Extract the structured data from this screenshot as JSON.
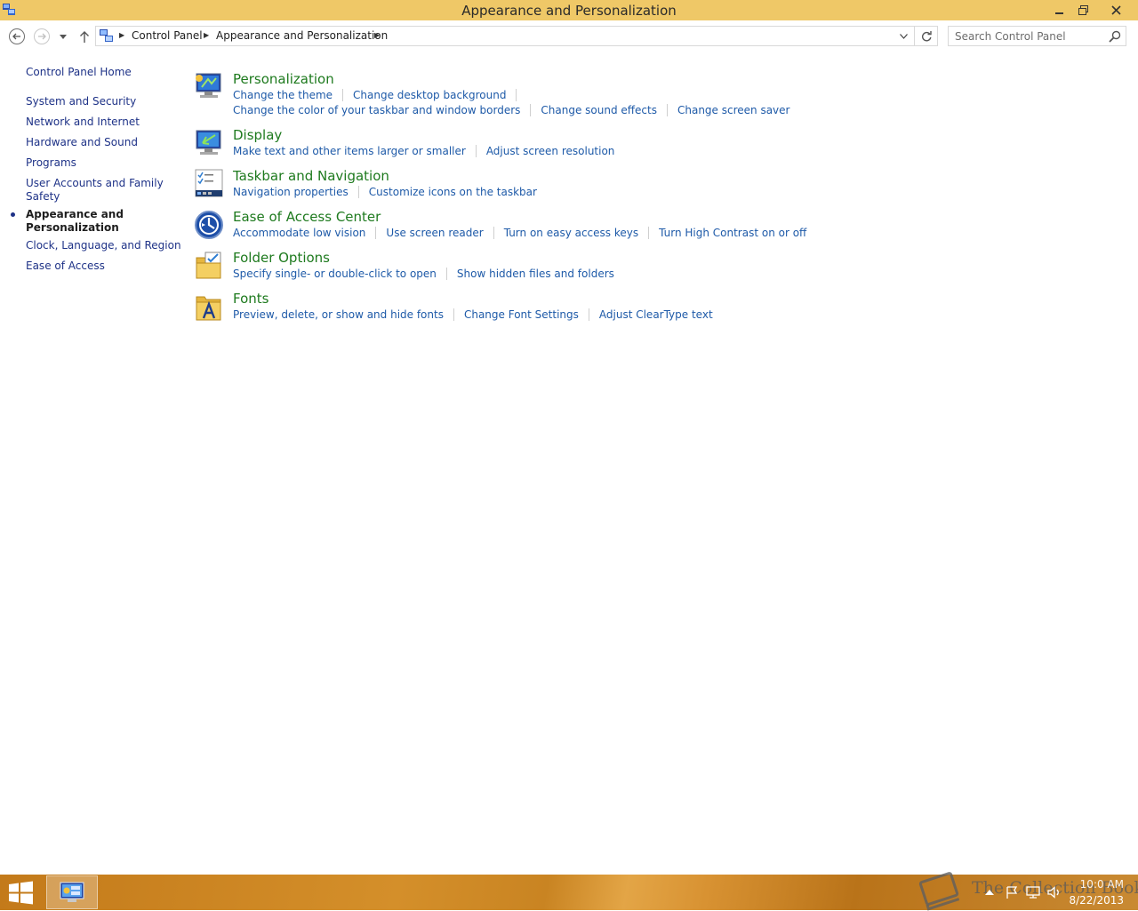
{
  "window": {
    "title": "Appearance and Personalization"
  },
  "address_bar": {
    "breadcrumbs": [
      "Control Panel",
      "Appearance and Personalization"
    ]
  },
  "search": {
    "placeholder": "Search Control Panel"
  },
  "left_nav": {
    "home": "Control Panel Home",
    "items": [
      "System and Security",
      "Network and Internet",
      "Hardware and Sound",
      "Programs",
      "User Accounts and Family",
      "Safety",
      "Appearance and",
      "Personalization",
      "Clock, Language, and Region",
      "Ease of Access"
    ]
  },
  "categories": [
    {
      "title": "Personalization",
      "icon": "personalization-icon",
      "tasks_line1": [
        "Change the theme",
        "Change desktop background"
      ],
      "tasks_line2": [
        "Change the color of your taskbar and window borders",
        "Change sound effects",
        "Change screen saver"
      ]
    },
    {
      "title": "Display",
      "icon": "display-icon",
      "tasks_line1": [
        "Make text and other items larger or smaller",
        "Adjust screen resolution"
      ]
    },
    {
      "title": "Taskbar and Navigation",
      "icon": "taskbar-icon",
      "tasks_line1": [
        "Navigation properties",
        "Customize icons on the taskbar"
      ]
    },
    {
      "title": "Ease of Access Center",
      "icon": "ease-of-access-icon",
      "tasks_line1": [
        "Accommodate low vision",
        "Use screen reader",
        "Turn on easy access keys",
        "Turn High Contrast on or off"
      ]
    },
    {
      "title": "Folder Options",
      "icon": "folder-options-icon",
      "tasks_line1": [
        "Specify single- or double-click to open",
        "Show hidden files and folders"
      ]
    },
    {
      "title": "Fonts",
      "icon": "fonts-icon",
      "tasks_line1": [
        "Preview, delete, or show and hide fonts",
        "Change Font Settings",
        "Adjust ClearType text"
      ]
    }
  ],
  "taskbar": {
    "time": "10:0 AM",
    "date": "8/22/2013",
    "watermark": "The Collection Book"
  },
  "colors": {
    "title_bar": "#efc867",
    "link": "#1e5aa8",
    "category_title": "#1e7a1e",
    "nav_link": "#1e3287"
  }
}
